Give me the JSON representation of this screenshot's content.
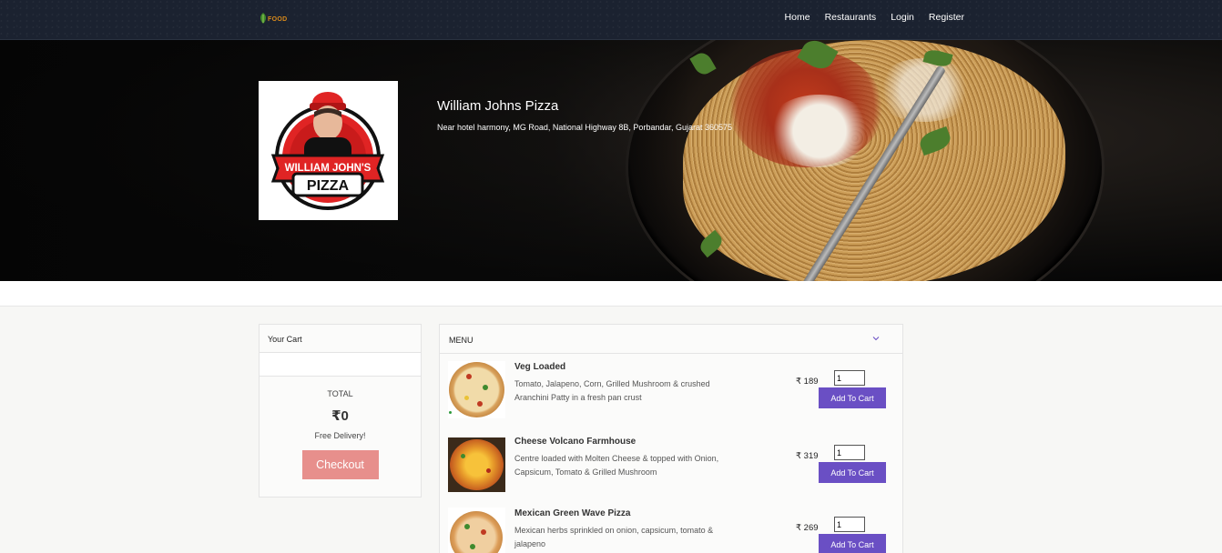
{
  "nav": {
    "logo_text": "FOOD",
    "links": [
      "Home",
      "Restaurants",
      "Login",
      "Register"
    ]
  },
  "restaurant": {
    "name": "William Johns Pizza",
    "address": "Near hotel harmony, MG Road, National Highway 8B, Porbandar, Gujarat 360575",
    "logo_lines": [
      "WILLIAM JOHN'S",
      "PIZZA"
    ]
  },
  "cart": {
    "title": "Your Cart",
    "total_label": "TOTAL",
    "total_value": "₹0",
    "delivery_text": "Free Delivery!",
    "checkout_label": "Checkout"
  },
  "menu": {
    "title": "MENU",
    "items": [
      {
        "name": "Veg Loaded",
        "description": "Tomato, Jalapeno, Corn, Grilled Mushroom & crushed Aranchini Patty in a fresh pan crust",
        "price": "₹ 189",
        "quantity": "1",
        "button": "Add To Cart"
      },
      {
        "name": "Cheese Volcano Farmhouse",
        "description": "Centre loaded with Molten Cheese & topped with Onion, Capsicum, Tomato & Grilled Mushroom",
        "price": "₹ 319",
        "quantity": "1",
        "button": "Add To Cart"
      },
      {
        "name": "Mexican Green Wave Pizza",
        "description": "Mexican herbs sprinkled on onion, capsicum, tomato & jalapeno",
        "price": "₹ 269",
        "quantity": "1",
        "button": "Add To Cart"
      }
    ]
  },
  "colors": {
    "navbar": "#1b2230",
    "checkout": "#e78f8c",
    "add_to_cart": "#6a4fc4"
  }
}
